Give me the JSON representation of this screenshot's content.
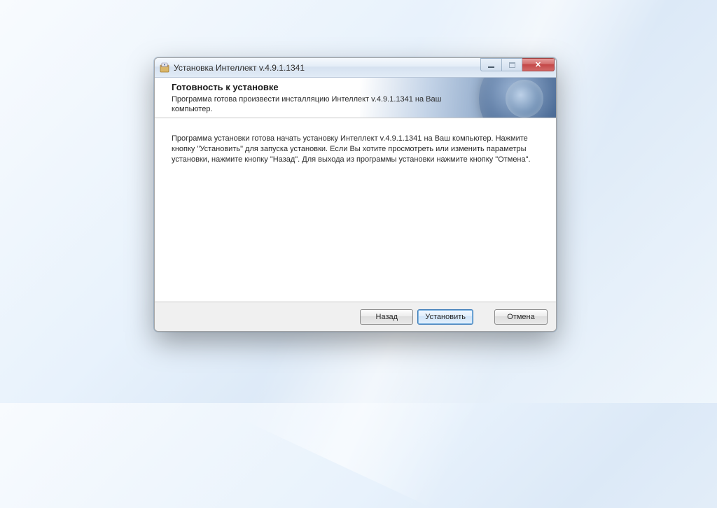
{
  "window": {
    "title": "Установка Интеллект v.4.9.1.1341"
  },
  "header": {
    "title": "Готовность к установке",
    "subtitle": "Программа готова произвести инсталляцию Интеллект v.4.9.1.1341 на Ваш компьютер."
  },
  "body": {
    "text": "Программа установки готова начать установку Интеллект v.4.9.1.1341 на Ваш компьютер. Нажмите кнопку \"Установить\" для запуска установки. Если Вы хотите просмотреть или изменить параметры установки, нажмите кнопку \"Назад\". Для выхода из программы установки нажмите кнопку \"Отмена\"."
  },
  "buttons": {
    "back": "Назад",
    "install": "Установить",
    "cancel": "Отмена"
  }
}
